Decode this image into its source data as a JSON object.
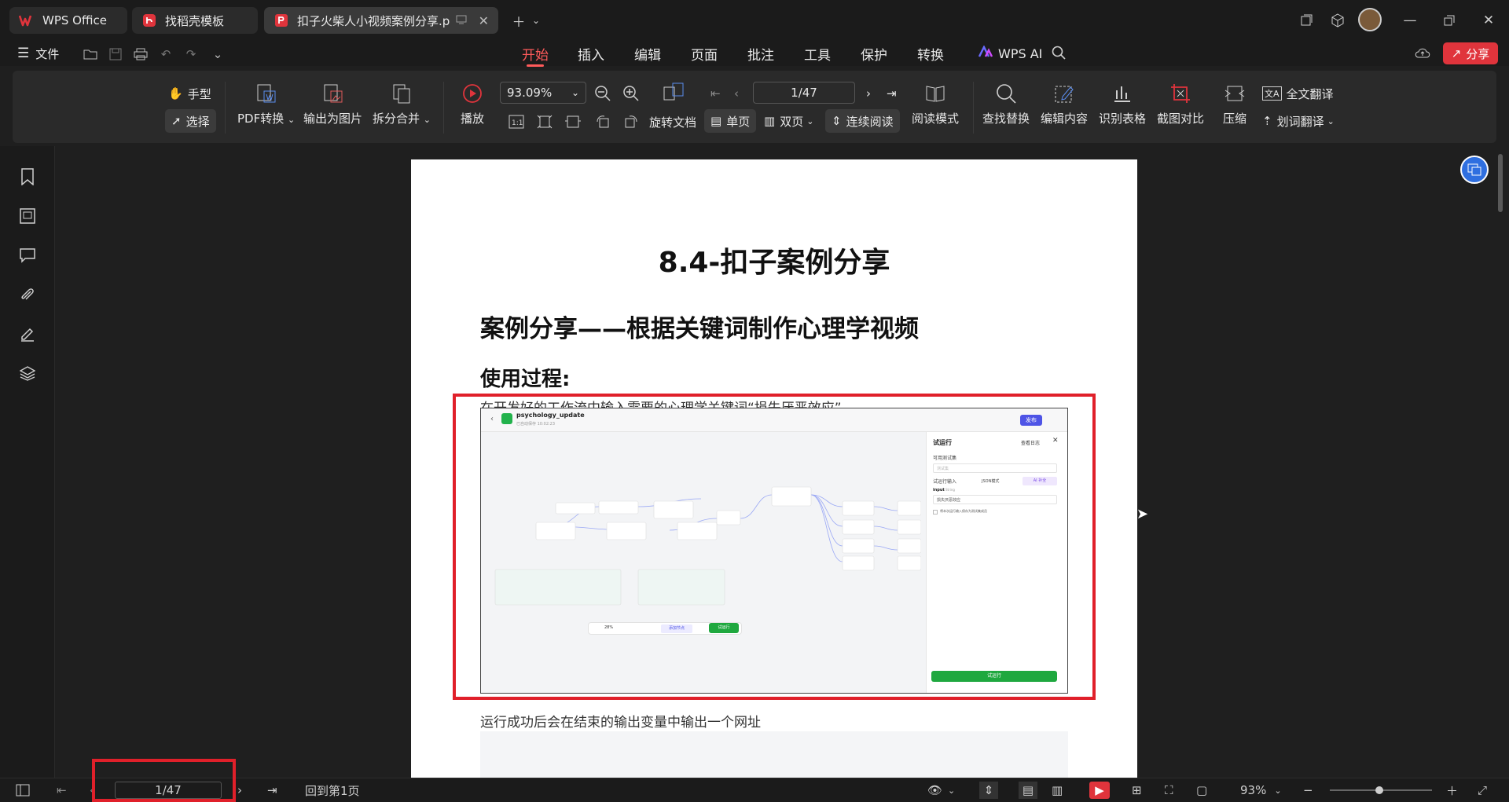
{
  "tabs": [
    {
      "label": "WPS Office",
      "icon": "wps-logo-icon",
      "active": false
    },
    {
      "label": "找稻壳模板",
      "icon": "docer-icon",
      "active": false
    },
    {
      "label": "扣子火柴人小视频案例分享.p",
      "icon": "pdf-icon",
      "active": true
    }
  ],
  "menu": {
    "file_label": "文件",
    "items": [
      "开始",
      "插入",
      "编辑",
      "页面",
      "批注",
      "工具",
      "保护",
      "转换"
    ],
    "active_index": 0,
    "wps_ai_label": "WPS AI",
    "share_label": "分享"
  },
  "ribbon": {
    "hand_label": "手型",
    "select_label": "选择",
    "pdf_convert_label": "PDF转换",
    "export_image_label": "输出为图片",
    "split_merge_label": "拆分合并",
    "play_label": "播放",
    "zoom_value": "93.09%",
    "page_value": "1/47",
    "rotate_label": "旋转文档",
    "single_label": "单页",
    "double_label": "双页",
    "continuous_label": "连续阅读",
    "read_mode_label": "阅读模式",
    "find_replace_label": "查找替换",
    "edit_content_label": "编辑内容",
    "recognize_table_label": "识别表格",
    "screenshot_compare_label": "截图对比",
    "compress_label": "压缩",
    "full_translate_label": "全文翻译",
    "word_translate_label": "划词翻译"
  },
  "document": {
    "title": "8.4-扣子案例分享",
    "subtitle": "案例分享——根据关键词制作心理学视频",
    "section": "使用过程:",
    "para1": "在开发好的工作流中输入需要的心理学关键词“损失厌恶效应”",
    "para2": "运行成功后会在结束的输出变量中输出一个网址",
    "embedded": {
      "app_name": "psychology_update",
      "app_sub": "已自动保存 10:02:23",
      "publish_label": "发布",
      "panel_title": "试运行",
      "view_log": "查看日志",
      "testset_label": "可用测试集",
      "testset_placeholder": "测试集",
      "input_label": "试运行输入",
      "json_mode": "JSON模式",
      "ai_complete": "AI 补全",
      "input_name": "input",
      "input_type": "String",
      "input_value": "损失厌恶效应",
      "save_hint": "将本次运行输入保存为测试集成员",
      "run_button": "试运行",
      "zoom": "28%",
      "add_node": "添加节点",
      "canvas_run": "试运行"
    }
  },
  "status": {
    "page_value": "1/47",
    "back_to_first": "回到第1页",
    "zoom_value": "93%"
  }
}
